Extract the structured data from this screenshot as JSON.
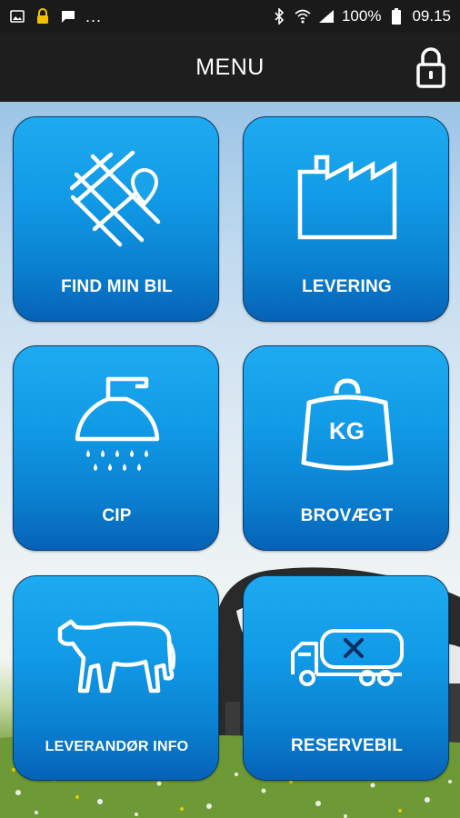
{
  "status_bar": {
    "left_icons": [
      "image-icon",
      "lock-icon",
      "message-icon"
    ],
    "overflow": "...",
    "battery": "100%",
    "time": "09.15"
  },
  "app_bar": {
    "title": "MENU",
    "lock_icon": "padlock-icon"
  },
  "menu": {
    "tiles": [
      {
        "label": "FIND MIN BIL",
        "icon": "map-pin-icon"
      },
      {
        "label": "LEVERING",
        "icon": "factory-icon"
      },
      {
        "label": "CIP",
        "icon": "shower-icon"
      },
      {
        "label": "BROVÆGT",
        "icon": "weight-icon",
        "icon_text": "KG"
      },
      {
        "label": "LEVERANDØR INFO",
        "icon": "cow-icon"
      },
      {
        "label": "RESERVEBIL",
        "icon": "tanker-truck-icon"
      }
    ]
  },
  "colors": {
    "tile_top": "#1eaaf0",
    "tile_bottom": "#0662b6",
    "app_bar": "#1e1e1e",
    "status_bar": "#1a1a1a"
  }
}
